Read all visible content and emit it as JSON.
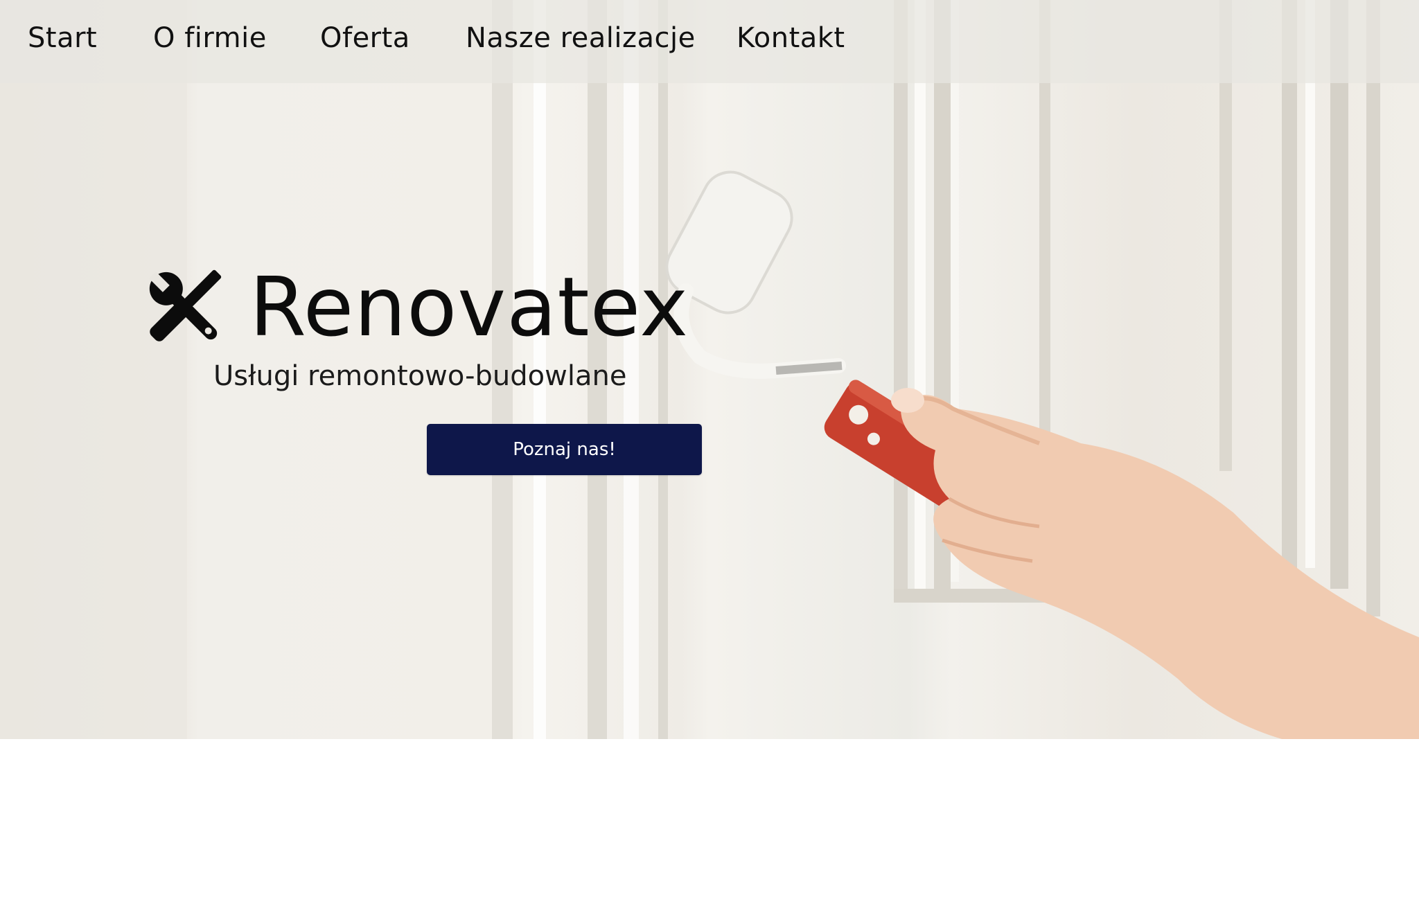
{
  "nav": {
    "items": [
      {
        "label": "Start"
      },
      {
        "label": "O firmie"
      },
      {
        "label": "Oferta"
      },
      {
        "label": "Nasze realizacje"
      },
      {
        "label": "Kontakt"
      }
    ]
  },
  "hero": {
    "brand_name": "Renovatex",
    "brand_icon": "tools-icon",
    "tagline": "Usługi remontowo-budowlane",
    "cta_label": "Poznaj nas!",
    "background": "photo-hand-painting-wall-with-roller"
  },
  "colors": {
    "cta_background": "#0e174a",
    "cta_text": "#ffffff",
    "roller_handle": "#c8402e"
  }
}
